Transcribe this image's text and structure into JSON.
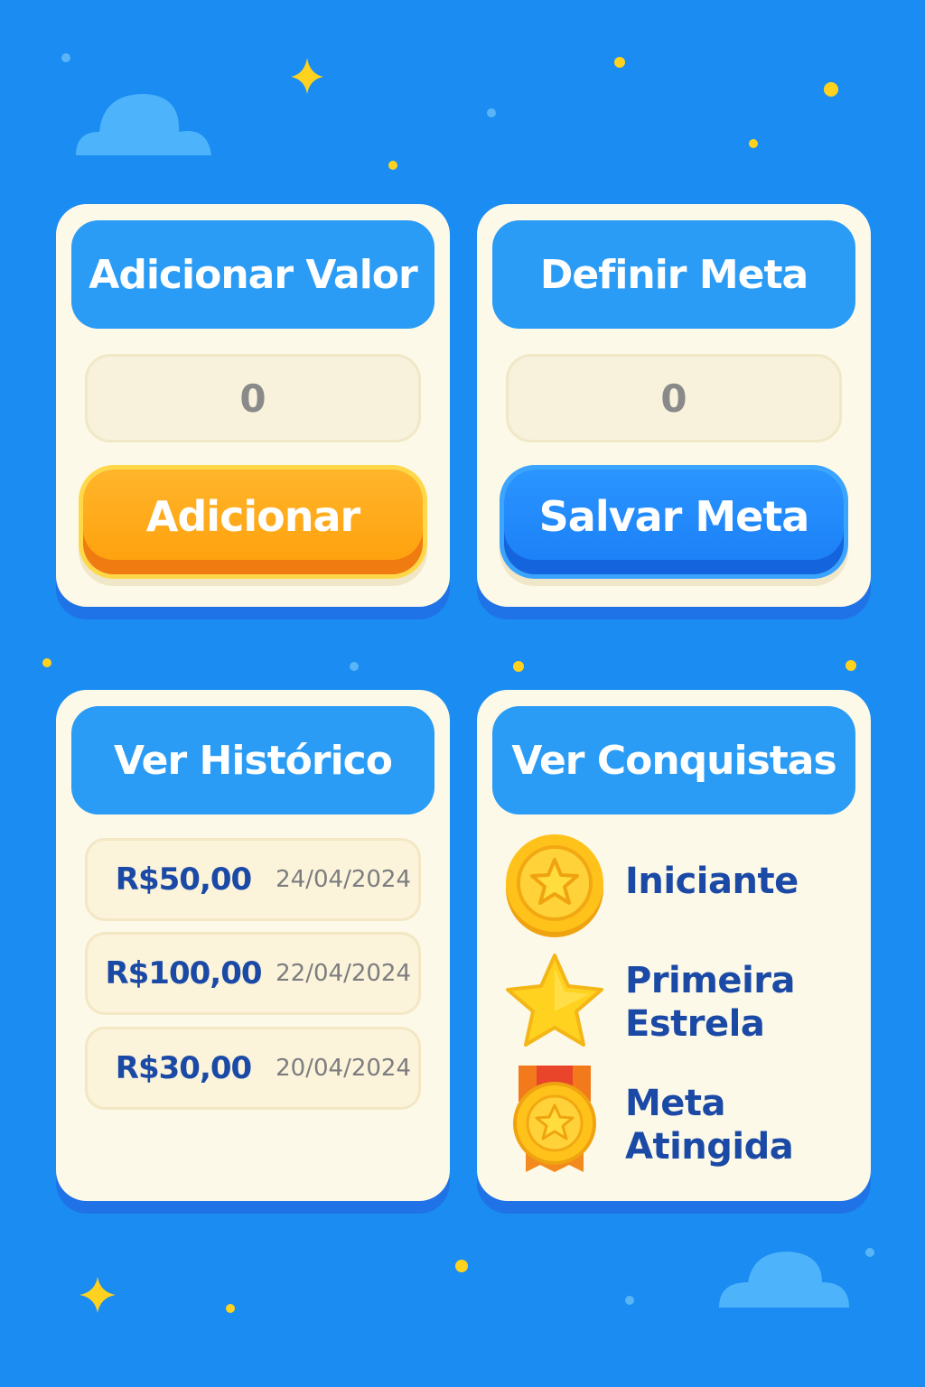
{
  "add_card": {
    "title": "Adicionar Valor",
    "input_value": "0",
    "button_label": "Adicionar"
  },
  "goal_card": {
    "title": "Definir Meta",
    "input_value": "0",
    "button_label": "Salvar Meta"
  },
  "history_card": {
    "title": "Ver Histórico",
    "entries": [
      {
        "amount": "R$50,00",
        "date": "24/04/2024"
      },
      {
        "amount": "R$100,00",
        "date": "22/04/2024"
      },
      {
        "amount": "R$30,00",
        "date": "20/04/2024"
      }
    ]
  },
  "achievements_card": {
    "title": "Ver Conquistas",
    "items": [
      {
        "label": "Iniciante",
        "icon": "gold-coin-star-icon"
      },
      {
        "label": "Primeira Estrela",
        "icon": "star-icon"
      },
      {
        "label": "Meta Atingida",
        "icon": "medal-icon"
      }
    ]
  },
  "colors": {
    "background": "#1a8cf2",
    "card": "#fdf9e8",
    "header": "#2b9cf5",
    "orange_button": "#ff9f0a",
    "blue_button": "#1a7ef6",
    "text_blue": "#1b4aa6"
  }
}
